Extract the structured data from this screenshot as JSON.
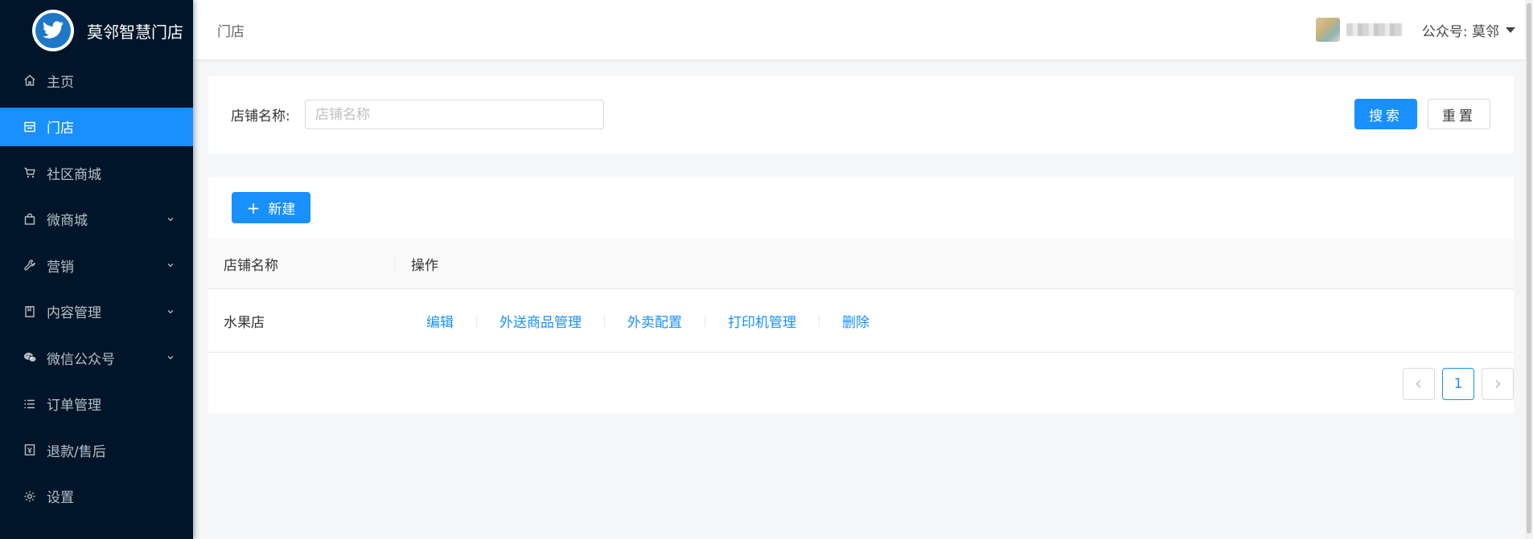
{
  "sidebar": {
    "logo_title": "莫邻智慧门店",
    "items": [
      {
        "label": "主页",
        "icon": "home-icon",
        "active": false,
        "has_arrow": false
      },
      {
        "label": "门店",
        "icon": "store-icon",
        "active": true,
        "has_arrow": false
      },
      {
        "label": "社区商城",
        "icon": "cart-icon",
        "active": false,
        "has_arrow": false
      },
      {
        "label": "微商城",
        "icon": "bag-icon",
        "active": false,
        "has_arrow": true
      },
      {
        "label": "营销",
        "icon": "wrench-icon",
        "active": false,
        "has_arrow": true
      },
      {
        "label": "内容管理",
        "icon": "book-icon",
        "active": false,
        "has_arrow": true
      },
      {
        "label": "微信公众号",
        "icon": "wechat-icon",
        "active": false,
        "has_arrow": true
      },
      {
        "label": "订单管理",
        "icon": "list-icon",
        "active": false,
        "has_arrow": false
      },
      {
        "label": "退款/售后",
        "icon": "refund-icon",
        "active": false,
        "has_arrow": false
      },
      {
        "label": "设置",
        "icon": "gear-icon",
        "active": false,
        "has_arrow": false
      }
    ]
  },
  "header": {
    "breadcrumb": "门店",
    "account": "公众号: 莫邻"
  },
  "search": {
    "label": "店铺名称:",
    "placeholder": "店铺名称",
    "value": "",
    "search_label": "搜索",
    "reset_label": "重置"
  },
  "table": {
    "new_label": "新建",
    "columns": [
      "店铺名称",
      "操作"
    ],
    "rows": [
      {
        "name": "水果店",
        "actions": [
          "编辑",
          "外送商品管理",
          "外卖配置",
          "打印机管理",
          "删除"
        ]
      }
    ]
  },
  "pagination": {
    "current": "1"
  },
  "colors": {
    "primary": "#1890ff",
    "sidebar_bg": "#001529",
    "page_bg": "#f5f6f8"
  }
}
